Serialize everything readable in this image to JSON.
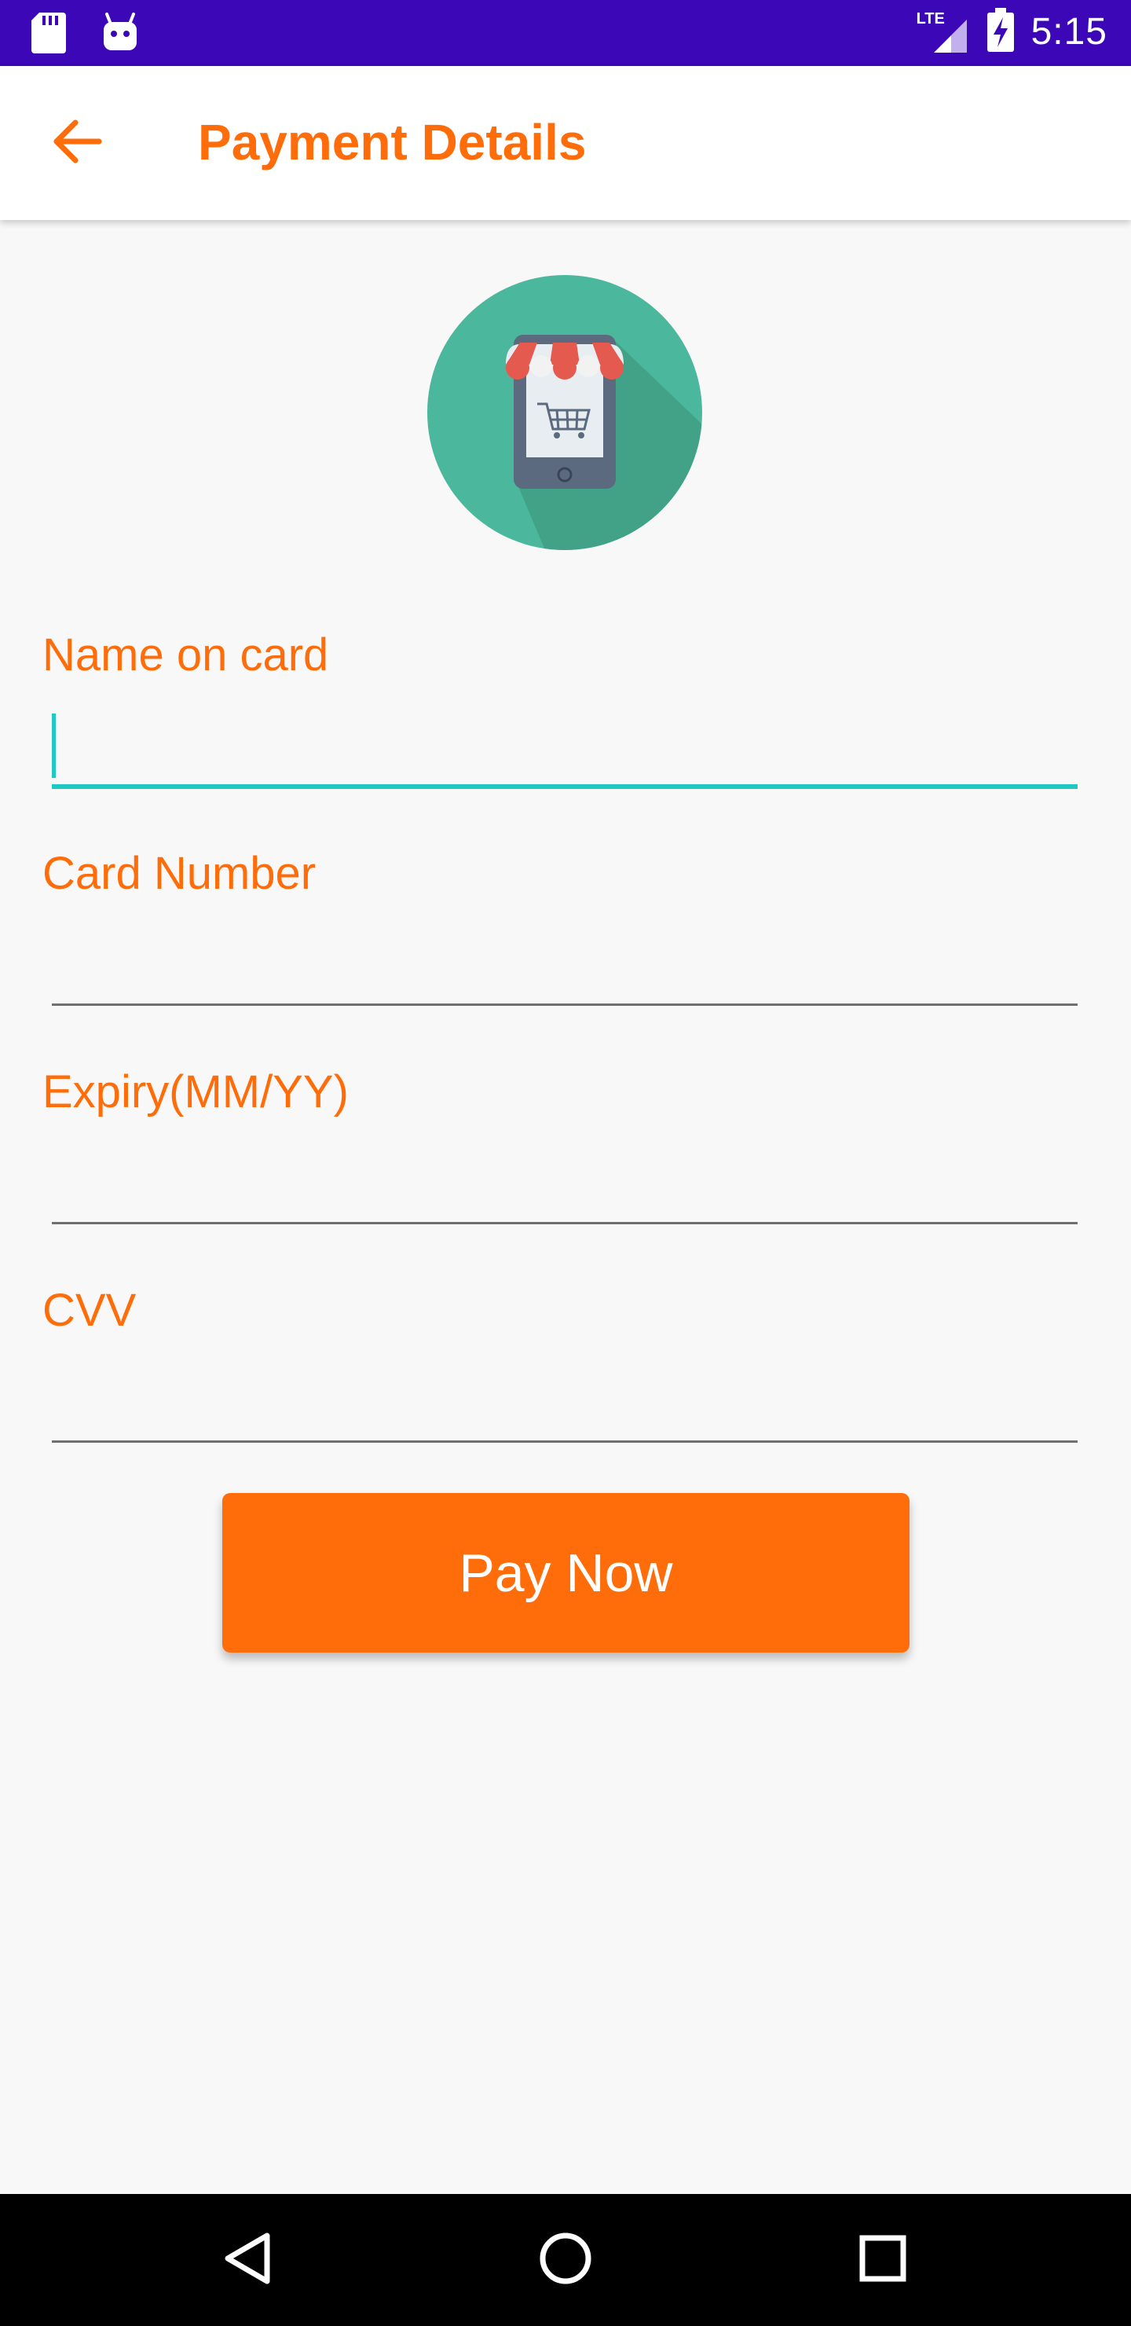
{
  "status_bar": {
    "time": "5:15",
    "network": "LTE",
    "left_icons": [
      "sd-card-icon",
      "android-icon"
    ],
    "right_icons": [
      "signal-icon",
      "battery-charging-icon"
    ]
  },
  "app_bar": {
    "title": "Payment Details",
    "back_icon": "arrow-left-icon"
  },
  "hero": {
    "icon": "mobile-shop-icon"
  },
  "form": {
    "fields": [
      {
        "label": "Name on card",
        "value": "",
        "focused": true
      },
      {
        "label": "Card Number",
        "value": "",
        "focused": false
      },
      {
        "label": "Expiry(MM/YY)",
        "value": "",
        "focused": false
      },
      {
        "label": "CVV",
        "value": "",
        "focused": false
      }
    ],
    "submit_label": "Pay Now"
  },
  "nav_bar": {
    "buttons": [
      "back-triangle-icon",
      "home-circle-icon",
      "recents-square-icon"
    ]
  },
  "colors": {
    "status_bar": "#3b07b7",
    "accent": "#ff6d0a",
    "focus": "#1fc8c0",
    "background": "#f8f8f8"
  }
}
